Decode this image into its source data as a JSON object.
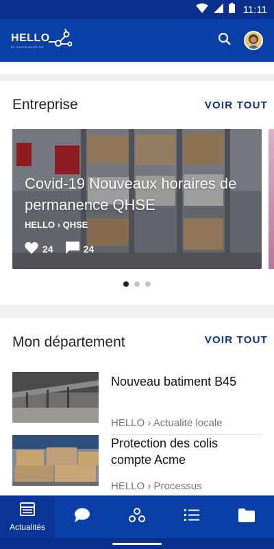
{
  "status": {
    "time": "11:11"
  },
  "app_bar": {
    "logo_text": "HELLO",
    "logo_tagline": "BY KUDOS BOOSTER"
  },
  "entreprise": {
    "title": "Entreprise",
    "see_all": "VOIR TOUT",
    "slide": {
      "title": "Covid-19 Nouveaux horaires de permanence QHSE",
      "crumb_root": "HELLO",
      "crumb_leaf": "QHSE",
      "likes": "24",
      "comments": "24"
    },
    "page_count": 3,
    "current_page": 1
  },
  "department": {
    "title": "Mon département",
    "see_all": "VOIR TOUT",
    "articles": [
      {
        "title": "Nouveau batiment B45",
        "crumb_root": "HELLO",
        "crumb_leaf": "Actualité locale"
      },
      {
        "title": "Protection des colis compte Acme",
        "crumb_root": "HELLO",
        "crumb_leaf": "Processus"
      }
    ]
  },
  "bottom_nav": {
    "items": [
      {
        "label": "Actualités",
        "icon": "news-icon",
        "active": true
      },
      {
        "label": "",
        "icon": "chat-icon"
      },
      {
        "label": "",
        "icon": "groups-icon"
      },
      {
        "label": "",
        "icon": "list-icon"
      },
      {
        "label": "",
        "icon": "folder-icon"
      }
    ]
  },
  "colors": {
    "brand": "#0b3fa8",
    "accent_text": "#0a2f8c"
  }
}
